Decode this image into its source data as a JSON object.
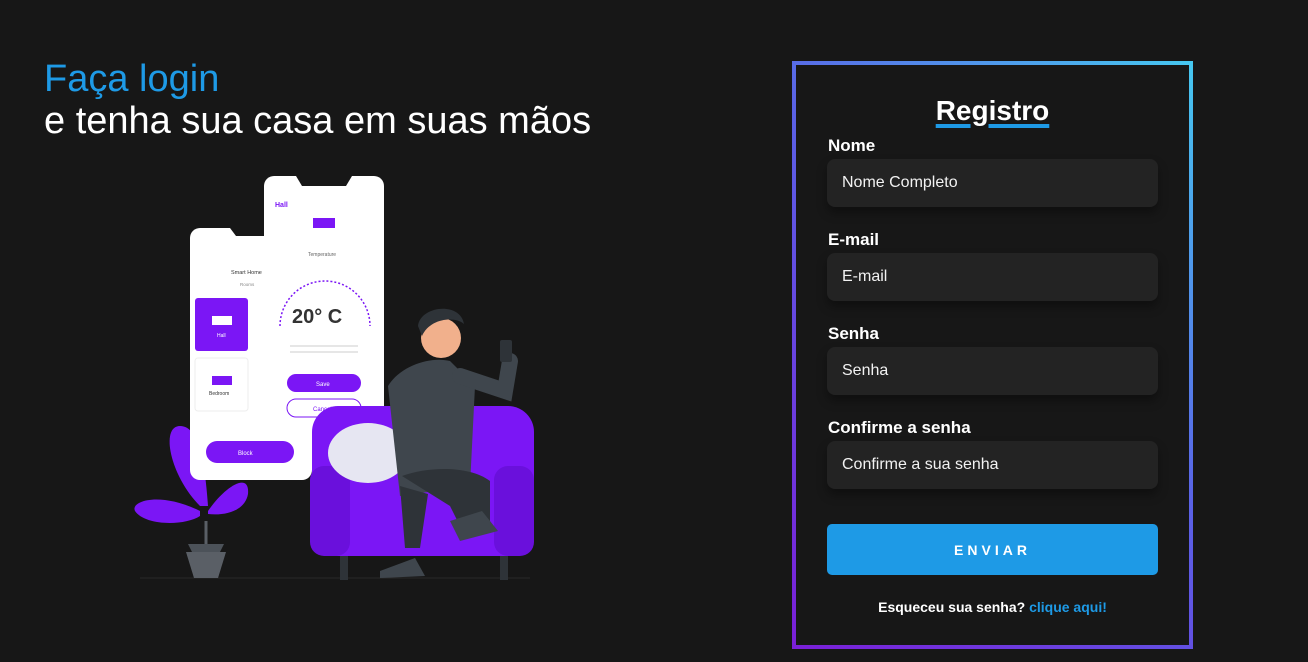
{
  "hero": {
    "title": "Faça login",
    "subtitle": "e tenha sua casa em suas mãos"
  },
  "illustration": {
    "phone_back": {
      "title": "Smart Home",
      "subtitle": "Rooms",
      "room1": "Hall",
      "room2": "Bedroom",
      "button": "Block"
    },
    "phone_front": {
      "back_label": "Hall",
      "temp_label": "Temperature",
      "temperature": "20° C",
      "save": "Save",
      "cancel": "Cancel"
    }
  },
  "form": {
    "title": "Registro",
    "fields": [
      {
        "label": "Nome",
        "placeholder": "Nome Completo"
      },
      {
        "label": "E-mail",
        "placeholder": "E-mail"
      },
      {
        "label": "Senha",
        "placeholder": "Senha"
      },
      {
        "label": "Confirme a senha",
        "placeholder": "Confirme a sua senha"
      }
    ],
    "submit_label": "ENVIAR",
    "forgot_text": "Esqueceu sua senha?",
    "forgot_link": "clique aqui!"
  },
  "colors": {
    "background": "#171717",
    "accent": "#1e9ae6",
    "purple": "#7b16f5",
    "input_bg": "#232323"
  }
}
